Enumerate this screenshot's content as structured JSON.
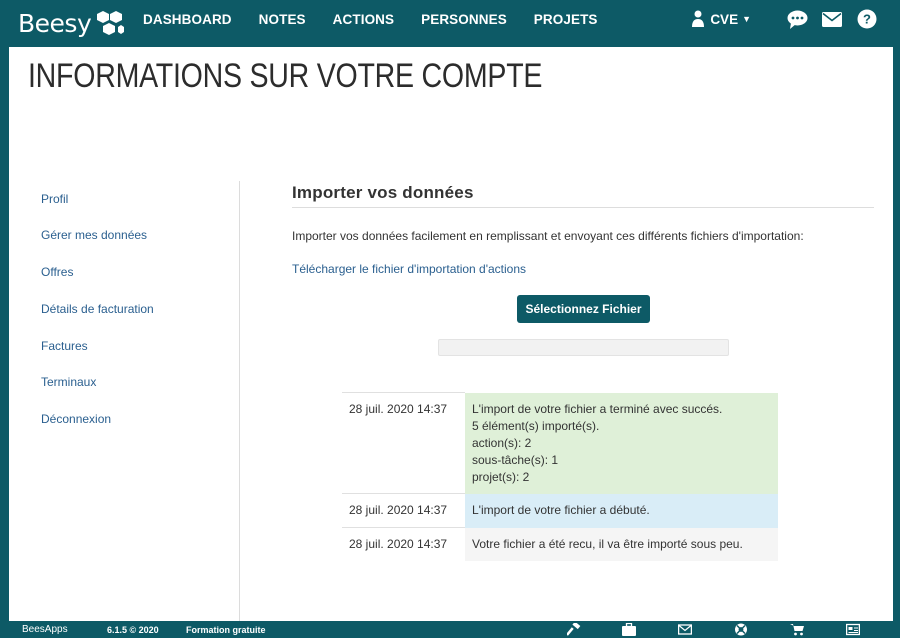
{
  "app": {
    "brand": "Beesy"
  },
  "nav": {
    "items": [
      {
        "label": "DASHBOARD"
      },
      {
        "label": "NOTES"
      },
      {
        "label": "ACTIONS"
      },
      {
        "label": "PERSONNES"
      },
      {
        "label": "PROJETS"
      }
    ],
    "user": {
      "initials": "CVE"
    },
    "icons": [
      "chat-icon",
      "mail-icon",
      "help-icon"
    ]
  },
  "page": {
    "title": "INFORMATIONS SUR VOTRE COMPTE"
  },
  "sidebar": {
    "items": [
      {
        "label": "Profil"
      },
      {
        "label": "Gérer mes données"
      },
      {
        "label": "Offres"
      },
      {
        "label": "Détails de facturation"
      },
      {
        "label": "Factures"
      },
      {
        "label": "Terminaux"
      },
      {
        "label": "Déconnexion"
      }
    ]
  },
  "import": {
    "title": "Importer vos données",
    "intro": "Importer vos données facilement en remplissant et envoyant ces différents fichiers d'importation:",
    "download_link": "Télécharger le fichier d'importation d'actions",
    "select_button": "Sélectionnez Fichier",
    "progress": 0
  },
  "log": [
    {
      "date": "28 juil. 2020 14:37",
      "status": "success",
      "lines": [
        "L'import de votre fichier a terminé avec succés.",
        "5 élément(s) importé(s).",
        "action(s): 2",
        "sous-tâche(s): 1",
        "projet(s): 2"
      ]
    },
    {
      "date": "28 juil. 2020 14:37",
      "status": "info",
      "lines": [
        "L'import de votre fichier a débuté."
      ]
    },
    {
      "date": "28 juil. 2020 14:37",
      "status": "plain",
      "lines": [
        "Votre fichier a été recu, il va être importé sous peu."
      ]
    }
  ],
  "footer": {
    "logo": "BeesApps",
    "version": "6.1.5 © 2020",
    "training": "Formation gratuite",
    "icons": [
      "hammer-icon",
      "briefcase-icon",
      "mail-icon",
      "support-icon",
      "cart-icon",
      "card-icon"
    ]
  },
  "colors": {
    "brand": "#0d5a66",
    "link": "#2a5f8f",
    "success_bg": "#dff0d8",
    "info_bg": "#d9edf7"
  }
}
